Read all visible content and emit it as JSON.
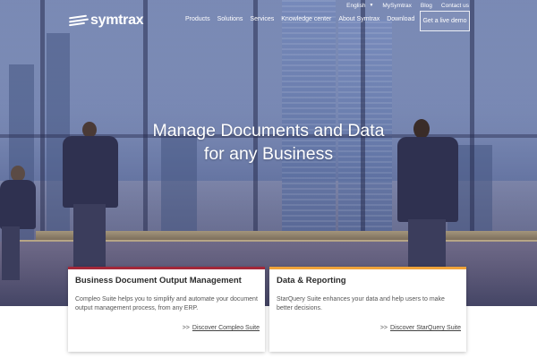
{
  "utility": {
    "language": "English",
    "links": [
      "MySymtrax",
      "Blog",
      "Contact us"
    ]
  },
  "logo": {
    "text": "symtrax"
  },
  "nav": {
    "items": [
      "Products",
      "Solutions",
      "Services",
      "Knowledge center",
      "About Symtrax",
      "Download"
    ],
    "demo_label": "Get a live demo"
  },
  "hero": {
    "line1": "Manage Documents and Data",
    "line2": "for any Business"
  },
  "cards": [
    {
      "title": "Business Document Output Management",
      "desc": "Compleo Suite helps you to simplify and automate your document output management process, from any ERP.",
      "prefix": ">>",
      "link": "Discover Compleo Suite",
      "accent": "#a3283a"
    },
    {
      "title": "Data & Reporting",
      "desc": "StarQuery Suite enhances your data and help users to make better decisions.",
      "prefix": ">>",
      "link": "Discover StarQuery Suite",
      "accent": "#f0a33a"
    }
  ]
}
